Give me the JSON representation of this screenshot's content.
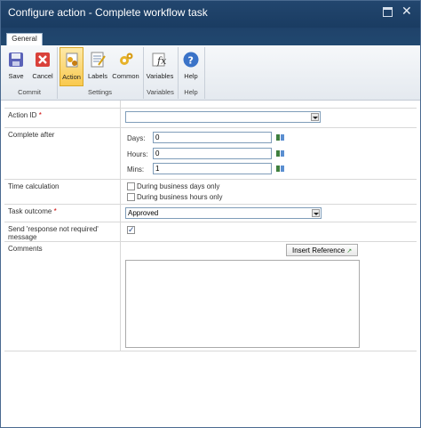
{
  "window": {
    "title": "Configure action - Complete workflow task"
  },
  "tabs": [
    {
      "label": "General"
    }
  ],
  "ribbon": {
    "buttons": [
      {
        "label": "Save",
        "icon": "save-icon"
      },
      {
        "label": "Cancel",
        "icon": "cancel-icon"
      },
      {
        "label": "Action",
        "icon": "action-icon"
      },
      {
        "label": "Labels",
        "icon": "labels-icon"
      },
      {
        "label": "Common",
        "icon": "common-icon"
      },
      {
        "label": "Variables",
        "icon": "variables-icon"
      },
      {
        "label": "Help",
        "icon": "help-icon"
      }
    ],
    "groups": [
      {
        "label": "Commit"
      },
      {
        "label": "Settings"
      },
      {
        "label": "Variables"
      },
      {
        "label": "Help"
      }
    ]
  },
  "form": {
    "action_id": {
      "label": "Action ID",
      "required_mark": "*",
      "value": ""
    },
    "complete_after": {
      "label": "Complete after",
      "days_label": "Days:",
      "days_value": "0",
      "hours_label": "Hours:",
      "hours_value": "0",
      "mins_label": "Mins:",
      "mins_value": "1"
    },
    "time_calculation": {
      "label": "Time calculation",
      "option1": "During business days only",
      "option2": "During business hours only"
    },
    "task_outcome": {
      "label": "Task outcome",
      "required_mark": "*",
      "value": "Approved"
    },
    "send_response": {
      "label": "Send 'response not required' message",
      "checked": true
    },
    "comments": {
      "label": "Comments",
      "insert_reference": "Insert Reference"
    }
  },
  "colors": {
    "titlebar": "#1f426a",
    "accent": "#f9c94e",
    "required": "#cc0000"
  }
}
